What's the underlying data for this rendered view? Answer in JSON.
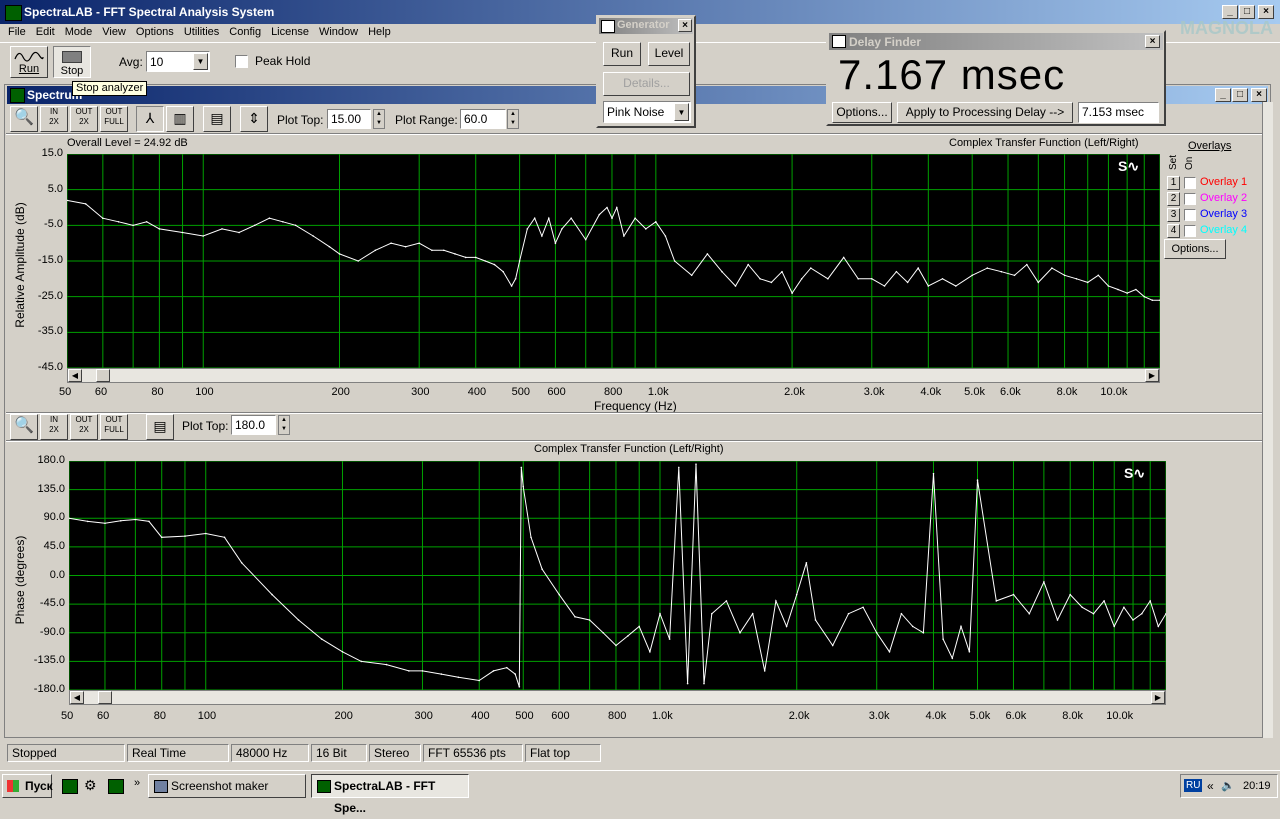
{
  "app": {
    "title": "SpectraLAB - FFT Spectral Analysis System",
    "menu": [
      "File",
      "Edit",
      "Mode",
      "View",
      "Options",
      "Utilities",
      "Config",
      "License",
      "Window",
      "Help"
    ]
  },
  "toolbar": {
    "run_label": "Run",
    "stop_label": "Stop",
    "avg_label": "Avg:",
    "avg_value": "10",
    "peak_hold_label": "Peak Hold",
    "tooltip": "Stop analyzer"
  },
  "spectrum_window": {
    "title": "Spectrum",
    "plot_top_label": "Plot Top:",
    "plot_top_value": "15.00",
    "plot_range_label": "Plot Range:",
    "plot_range_value": "60.0",
    "overall_level": "Overall Level = 24.92 dB",
    "amp_title": "Complex Transfer Function (Left/Right)",
    "amp_ylabel": "Relative Amplitude (dB)",
    "amp_yticks": [
      "15.0",
      "5.0",
      "-5.0",
      "-15.0",
      "-25.0",
      "-35.0",
      "-45.0"
    ],
    "freq_label": "Frequency (Hz)",
    "xticks": [
      "50",
      "60",
      "80",
      "100",
      "200",
      "300",
      "400",
      "500",
      "600",
      "800",
      "1.0k",
      "2.0k",
      "3.0k",
      "4.0k",
      "5.0k",
      "6.0k",
      "8.0k",
      "10.0k"
    ],
    "phase_plot_top_label": "Plot Top:",
    "phase_plot_top_value": "180.0",
    "phase_title": "Complex Transfer Function (Left/Right)",
    "phase_ylabel": "Phase (degrees)",
    "phase_yticks": [
      "180.0",
      "135.0",
      "90.0",
      "45.0",
      "0.0",
      "-45.0",
      "-90.0",
      "-135.0",
      "-180.0"
    ]
  },
  "overlays": {
    "title": "Overlays",
    "set_label": "Set",
    "on_label": "On",
    "items": [
      {
        "num": "1",
        "label": "Overlay 1",
        "color": "#ff0000"
      },
      {
        "num": "2",
        "label": "Overlay 2",
        "color": "#ff00ff"
      },
      {
        "num": "3",
        "label": "Overlay 3",
        "color": "#0000ff"
      },
      {
        "num": "4",
        "label": "Overlay 4",
        "color": "#00ffff"
      }
    ],
    "options_label": "Options..."
  },
  "generator": {
    "title": "Generator",
    "run_label": "Run",
    "level_label": "Level",
    "details_label": "Details...",
    "signal_value": "Pink Noise"
  },
  "delay_finder": {
    "title": "Delay Finder",
    "value": "7.167 msec",
    "options_label": "Options...",
    "apply_label": "Apply to Processing Delay -->",
    "processing_delay": "7.153 msec"
  },
  "status": [
    "Stopped",
    "Real Time",
    "48000 Hz",
    "16 Bit",
    "Stereo",
    "FFT 65536 pts",
    "Flat top"
  ],
  "taskbar": {
    "start_label": "Пуск",
    "task1": "Screenshot maker",
    "task2": "SpectraLAB - FFT Spe...",
    "lang": "RU",
    "clock": "20:19"
  },
  "chart_data": [
    {
      "type": "line",
      "title": "Complex Transfer Function (Left/Right)",
      "xlabel": "Frequency (Hz)",
      "ylabel": "Relative Amplitude (dB)",
      "xscale": "log",
      "xlim": [
        50,
        13000
      ],
      "ylim": [
        -45,
        15
      ],
      "grid": true,
      "x": [
        50,
        55,
        60,
        65,
        70,
        75,
        80,
        90,
        100,
        110,
        120,
        130,
        140,
        150,
        160,
        175,
        190,
        200,
        220,
        240,
        260,
        280,
        300,
        320,
        340,
        360,
        380,
        400,
        420,
        440,
        460,
        480,
        490,
        500,
        520,
        540,
        560,
        580,
        600,
        620,
        650,
        700,
        750,
        780,
        800,
        820,
        850,
        900,
        950,
        1000,
        1050,
        1100,
        1200,
        1300,
        1400,
        1500,
        1600,
        1700,
        1800,
        1900,
        2000,
        2100,
        2200,
        2400,
        2600,
        2800,
        3000,
        3200,
        3400,
        3600,
        3800,
        4000,
        4300,
        4600,
        5000,
        5400,
        5800,
        6200,
        6600,
        7000,
        7500,
        8000,
        8500,
        9000,
        9500,
        10000,
        10500,
        11000,
        11500,
        12000,
        12500,
        13000
      ],
      "y": [
        2,
        1,
        -3,
        -4,
        -5,
        -4,
        -6,
        -7,
        -8,
        -6,
        -7,
        -5,
        -3,
        -4,
        -5,
        -8,
        -11,
        -13,
        -15,
        -12,
        -10,
        -11,
        -10,
        -12,
        -12,
        -13,
        -14,
        -14,
        -15,
        -16,
        -18,
        -22,
        -20,
        -15,
        -6,
        -3,
        -8,
        -3,
        -10,
        -6,
        -3,
        -9,
        -2,
        0,
        -3,
        0,
        -8,
        -3,
        -6,
        -4,
        -8,
        -15,
        -19,
        -13,
        -18,
        -22,
        -16,
        -20,
        -21,
        -18,
        -24,
        -20,
        -17,
        -20,
        -14,
        -20,
        -20,
        -22,
        -18,
        -21,
        -17,
        -22,
        -20,
        -22,
        -19,
        -17,
        -18,
        -19,
        -16,
        -21,
        -17,
        -19,
        -20,
        -21,
        -19,
        -22,
        -23,
        -24,
        -23,
        -25,
        -26,
        -26
      ]
    },
    {
      "type": "line",
      "title": "Complex Transfer Function (Left/Right)",
      "xlabel": "",
      "ylabel": "Phase (degrees)",
      "xscale": "log",
      "xlim": [
        50,
        13000
      ],
      "ylim": [
        -180,
        180
      ],
      "grid": true,
      "x": [
        50,
        55,
        60,
        65,
        70,
        75,
        80,
        90,
        100,
        110,
        120,
        140,
        160,
        180,
        200,
        220,
        250,
        280,
        300,
        330,
        360,
        400,
        430,
        460,
        480,
        490,
        495,
        500,
        520,
        550,
        600,
        650,
        700,
        750,
        800,
        850,
        900,
        950,
        1000,
        1050,
        1100,
        1150,
        1200,
        1250,
        1300,
        1400,
        1500,
        1600,
        1700,
        1800,
        1900,
        2000,
        2100,
        2200,
        2400,
        2600,
        2800,
        3000,
        3200,
        3400,
        3600,
        3800,
        4000,
        4200,
        4400,
        4600,
        4800,
        5000,
        5500,
        6000,
        6500,
        7000,
        7500,
        8000,
        8500,
        9000,
        9500,
        10000,
        10500,
        11000,
        11500,
        12000,
        12500,
        13000
      ],
      "y": [
        90,
        85,
        82,
        86,
        88,
        85,
        60,
        62,
        66,
        60,
        20,
        -30,
        -70,
        -100,
        -120,
        -135,
        -140,
        -150,
        -150,
        -155,
        -160,
        -165,
        -150,
        -145,
        -155,
        -175,
        170,
        140,
        60,
        10,
        -30,
        -65,
        -70,
        -90,
        -110,
        -95,
        -80,
        -120,
        -60,
        -100,
        170,
        -170,
        175,
        -170,
        -60,
        -40,
        -90,
        -60,
        -150,
        -40,
        -80,
        -30,
        20,
        -70,
        -110,
        -60,
        -50,
        -90,
        -120,
        -60,
        -80,
        -90,
        160,
        -100,
        -130,
        -80,
        -120,
        150,
        -40,
        -30,
        -60,
        -10,
        -70,
        -30,
        -50,
        -60,
        -40,
        -80,
        -50,
        -70,
        -60,
        -40,
        -80,
        -60
      ]
    }
  ]
}
